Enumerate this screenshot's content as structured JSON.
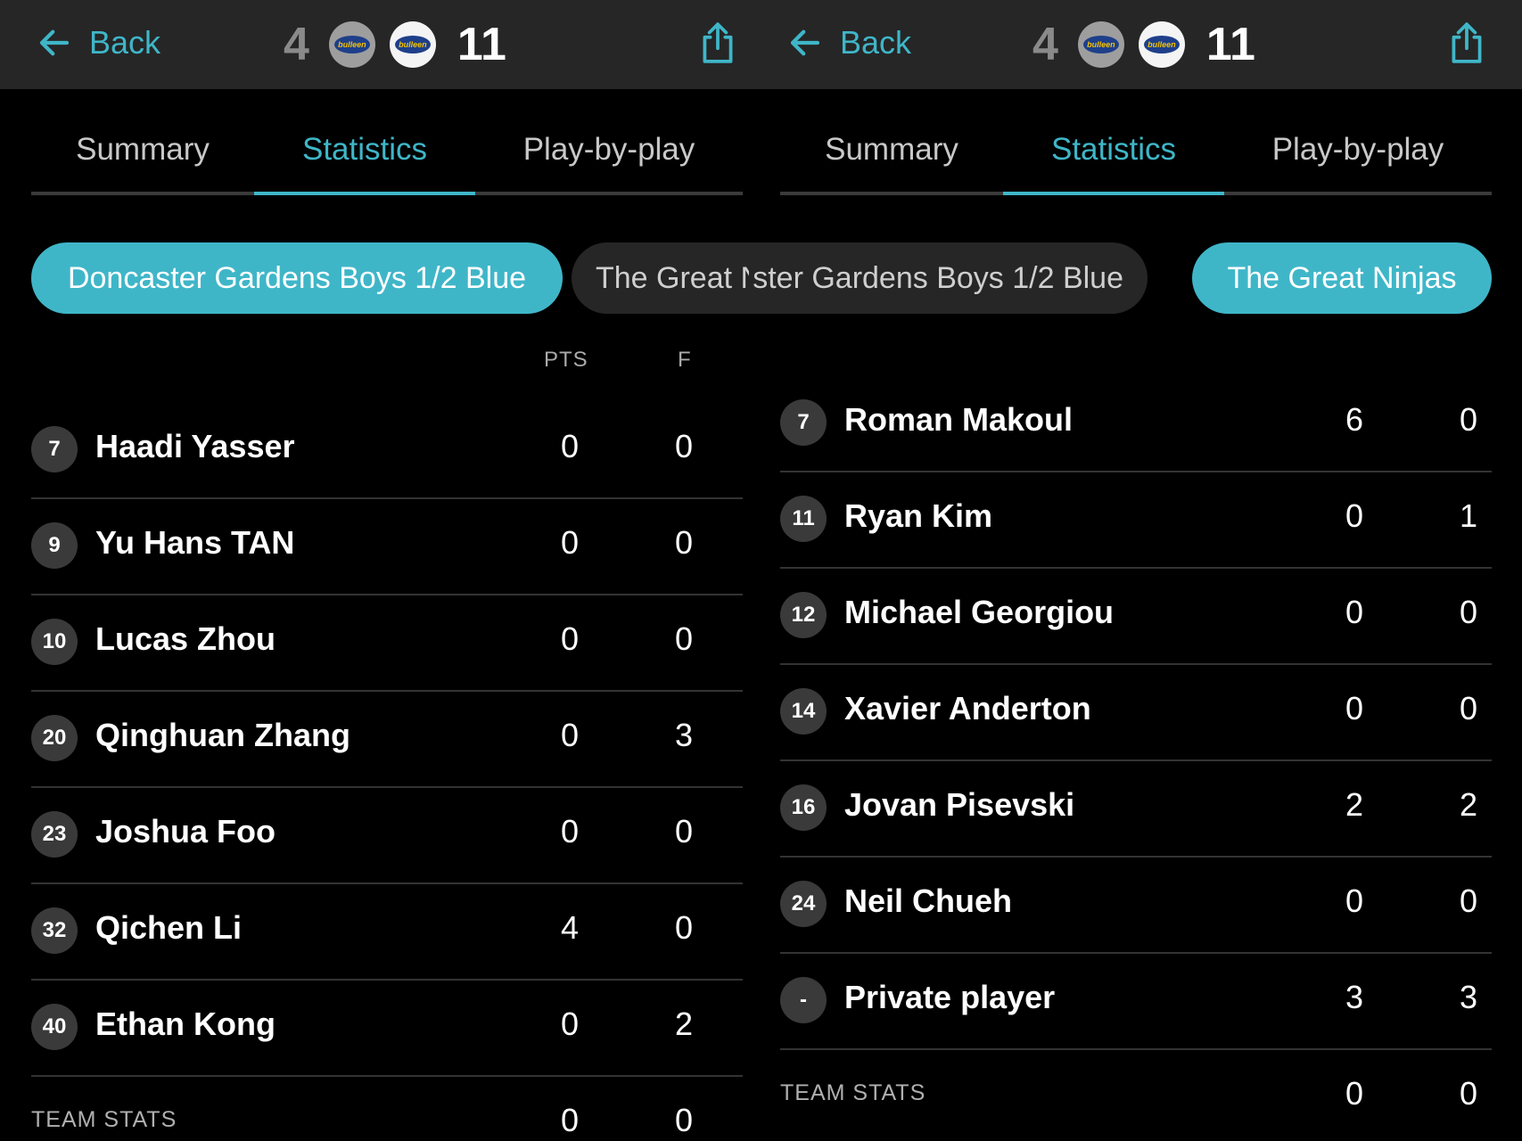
{
  "left": {
    "back_label": "Back",
    "score": {
      "home": "4",
      "away": "11"
    },
    "tabs": {
      "summary": "Summary",
      "statistics": "Statistics",
      "pbp": "Play-by-play"
    },
    "team_selector": {
      "active": "Doncaster Gardens Boys 1/2 Blue",
      "other": "The Great N"
    },
    "columns": {
      "pts": "PTS",
      "f": "F"
    },
    "players": [
      {
        "num": "7",
        "name": "Haadi Yasser",
        "pts": "0",
        "f": "0"
      },
      {
        "num": "9",
        "name": "Yu Hans TAN",
        "pts": "0",
        "f": "0"
      },
      {
        "num": "10",
        "name": "Lucas Zhou",
        "pts": "0",
        "f": "0"
      },
      {
        "num": "20",
        "name": "Qinghuan Zhang",
        "pts": "0",
        "f": "3"
      },
      {
        "num": "23",
        "name": "Joshua Foo",
        "pts": "0",
        "f": "0"
      },
      {
        "num": "32",
        "name": "Qichen Li",
        "pts": "4",
        "f": "0"
      },
      {
        "num": "40",
        "name": "Ethan Kong",
        "pts": "0",
        "f": "2"
      }
    ],
    "team_stats": {
      "label": "TEAM STATS",
      "pts": "0",
      "f": "0"
    }
  },
  "right": {
    "back_label": "Back",
    "score": {
      "home": "4",
      "away": "11"
    },
    "tabs": {
      "summary": "Summary",
      "statistics": "Statistics",
      "pbp": "Play-by-play"
    },
    "team_selector": {
      "other": "ster Gardens Boys 1/2 Blue",
      "active": "The Great Ninjas"
    },
    "players": [
      {
        "num": "7",
        "name": "Roman Makoul",
        "pts": "6",
        "f": "0"
      },
      {
        "num": "11",
        "name": "Ryan Kim",
        "pts": "0",
        "f": "1"
      },
      {
        "num": "12",
        "name": "Michael Georgiou",
        "pts": "0",
        "f": "0"
      },
      {
        "num": "14",
        "name": "Xavier Anderton",
        "pts": "0",
        "f": "0"
      },
      {
        "num": "16",
        "name": "Jovan Pisevski",
        "pts": "2",
        "f": "2"
      },
      {
        "num": "24",
        "name": "Neil Chueh",
        "pts": "0",
        "f": "0"
      },
      {
        "num": "-",
        "name": "Private player",
        "pts": "3",
        "f": "3"
      }
    ],
    "team_stats": {
      "label": "TEAM STATS",
      "pts": "0",
      "f": "0"
    }
  },
  "logo_text": "bulleen",
  "colors": {
    "accent": "#3fb6c8",
    "header_bg": "#262626",
    "background": "#000000",
    "divider": "#333333"
  }
}
